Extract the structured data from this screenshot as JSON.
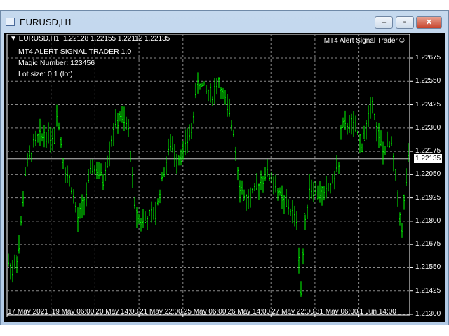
{
  "window": {
    "title": "EURUSD,H1",
    "minimize": "‒",
    "maximize": "▫",
    "close": "✕"
  },
  "chart_header": {
    "symbol": "EURUSD,H1",
    "ohlc": "1.22128 1.22155 1.22112 1.22135",
    "ea_name": "MT4 Alert Signal Trader",
    "ea_icon": "☺"
  },
  "info": {
    "line1": "MT4 ALERT SIGNAL TRADER 1.0",
    "line2": "Magic Number: 123456",
    "line3": "Lot size: 0.1 (lot)"
  },
  "colors": {
    "bars": "#00ff00",
    "grid": "#8a8a8a"
  },
  "chart_data": {
    "type": "bar",
    "symbol": "EURUSD",
    "timeframe": "H1",
    "current_price": "1.22135",
    "ylim": [
      1.213,
      1.22675
    ],
    "price_ticks": [
      "1.22675",
      "1.22550",
      "1.22425",
      "1.22300",
      "1.22175",
      "1.22050",
      "1.21925",
      "1.21800",
      "1.21675",
      "1.21550",
      "1.21425",
      "1.21300"
    ],
    "time_labels": [
      "17 May 2021",
      "19 May 06:00",
      "20 May 14:00",
      "21 May 22:00",
      "25 May 06:00",
      "26 May 14:00",
      "27 May 22:00",
      "31 May 06:00",
      "1 Jun 14:00"
    ],
    "bar_count": 191,
    "price_path": [
      [
        0,
        1.21576
      ],
      [
        2,
        1.21539
      ],
      [
        5,
        1.21651
      ],
      [
        8,
        1.22064
      ],
      [
        12,
        1.22214
      ],
      [
        15,
        1.22251
      ],
      [
        18,
        1.2227
      ],
      [
        22,
        1.22251
      ],
      [
        23,
        1.22401
      ],
      [
        27,
        1.22064
      ],
      [
        30,
        1.21989
      ],
      [
        33,
        1.21801
      ],
      [
        37,
        1.21951
      ],
      [
        40,
        1.22101
      ],
      [
        45,
        1.22026
      ],
      [
        50,
        1.22289
      ],
      [
        53,
        1.22364
      ],
      [
        57,
        1.22289
      ],
      [
        58,
        1.22176
      ],
      [
        60,
        1.21876
      ],
      [
        63,
        1.21801
      ],
      [
        67,
        1.2182
      ],
      [
        70,
        1.21839
      ],
      [
        73,
        1.22026
      ],
      [
        77,
        1.22214
      ],
      [
        80,
        1.22139
      ],
      [
        83,
        1.22176
      ],
      [
        87,
        1.22289
      ],
      [
        90,
        1.22551
      ],
      [
        93,
        1.22514
      ],
      [
        97,
        1.22476
      ],
      [
        100,
        1.22551
      ],
      [
        103,
        1.22439
      ],
      [
        107,
        1.22289
      ],
      [
        110,
        1.21989
      ],
      [
        113,
        1.21914
      ],
      [
        117,
        1.21951
      ],
      [
        120,
        1.22026
      ],
      [
        123,
        1.22064
      ],
      [
        127,
        1.21989
      ],
      [
        130,
        1.21914
      ],
      [
        133,
        1.21876
      ],
      [
        137,
        1.21801
      ],
      [
        139,
        1.21426
      ],
      [
        141,
        1.21801
      ],
      [
        143,
        1.21989
      ],
      [
        147,
        1.21951
      ],
      [
        150,
        1.21951
      ],
      [
        153,
        1.21989
      ],
      [
        157,
        1.22101
      ],
      [
        158,
        1.22289
      ],
      [
        162,
        1.22326
      ],
      [
        165,
        1.22289
      ],
      [
        168,
        1.22214
      ],
      [
        172,
        1.22401
      ],
      [
        173,
        1.22476
      ],
      [
        175,
        1.22289
      ],
      [
        178,
        1.22176
      ],
      [
        182,
        1.22214
      ],
      [
        185,
        1.21951
      ],
      [
        187,
        1.21726
      ],
      [
        188,
        1.21914
      ],
      [
        190,
        1.22135
      ]
    ]
  }
}
